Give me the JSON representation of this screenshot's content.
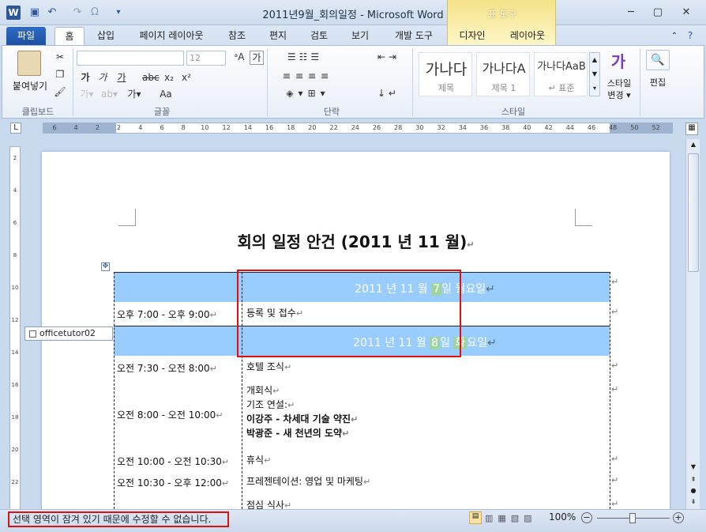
{
  "window": {
    "title": "2011년9월_회의일정 - Microsoft Word",
    "app_icon": "W"
  },
  "quick_access": [
    "save-icon",
    "undo-icon",
    "redo-icon",
    "omega-icon",
    "customize-icon"
  ],
  "contextual": {
    "label": "표 도구"
  },
  "tabs": {
    "file": "파일",
    "home": "홈",
    "insert": "삽입",
    "page_layout": "페이지 레이아웃",
    "references": "참조",
    "mailings": "편지",
    "review": "검토",
    "view": "보기",
    "developer": "개발 도구",
    "design": "디자인",
    "layout": "레이아웃"
  },
  "ribbon": {
    "clipboard": {
      "paste": "붙여넣기",
      "label": "클립보드"
    },
    "font": {
      "size": "12",
      "label": "글꼴",
      "btn_ga1": "가",
      "btn_ga2": "가",
      "btn_ga3": "가",
      "btn_aa": "Aa"
    },
    "paragraph": {
      "label": "단락"
    },
    "styles": {
      "label": "스타일",
      "items": [
        {
          "preview": "가나다",
          "name": "제목"
        },
        {
          "preview": "가나다A",
          "name": "제목 1"
        },
        {
          "preview": "가나다AaB",
          "name": "↵ 표준"
        }
      ],
      "change_styles": "스타일\n변경 ▾"
    },
    "editing": {
      "label": "편집"
    }
  },
  "ruler": {
    "ticks": [
      "6",
      "4",
      "2",
      "2",
      "4",
      "6",
      "8",
      "10",
      "12",
      "14",
      "16",
      "18",
      "20",
      "22",
      "24",
      "26",
      "28",
      "30",
      "32",
      "34",
      "36",
      "38",
      "40",
      "42",
      "44",
      "46",
      "48",
      "50",
      "52"
    ],
    "vticks": [
      "2",
      "4",
      "6",
      "8",
      "10",
      "12",
      "14",
      "16",
      "18",
      "20",
      "22"
    ]
  },
  "document": {
    "title": "회의 일정 안건 (2011 년 11 월)",
    "rows": [
      {
        "type": "head",
        "pre": "2011 년 11 월 ",
        "hl1": "7",
        "mid": "일 ",
        "hl2": "",
        "post": "월요일"
      },
      {
        "type": "row",
        "time": "오후 7:00 - 오후 9:00",
        "lines": [
          "등록 및 접수"
        ]
      },
      {
        "type": "head",
        "pre": "2011 년 11 월 ",
        "hl1": "8",
        "mid": "일 ",
        "hl2": "화",
        "post": "요일"
      },
      {
        "type": "row",
        "time": "오전 7:30 - 오전 8:00",
        "lines": [
          "호텔 조식"
        ]
      },
      {
        "type": "row",
        "time": "오전 8:00 - 오전 10:00",
        "lines": [
          "개회식",
          "기조 연설:",
          "이강주 - 차세대 기술 약진",
          "박광준 - 새 천년의 도약"
        ]
      },
      {
        "type": "row",
        "time": "오전 10:00 - 오전 10:30",
        "lines": [
          "휴식"
        ]
      },
      {
        "type": "row",
        "time": "오전 10:30 - 오후 12:00",
        "lines": [
          "프레젠테이션: 영업 및 마케팅"
        ]
      },
      {
        "type": "row",
        "time": "",
        "lines": [
          "점심 식사"
        ]
      }
    ],
    "content_control_tag": "officetutor02"
  },
  "status": {
    "message": "선택 영역이 잠겨 있기 때문에 수정할 수 없습니다.",
    "zoom": "100%"
  }
}
